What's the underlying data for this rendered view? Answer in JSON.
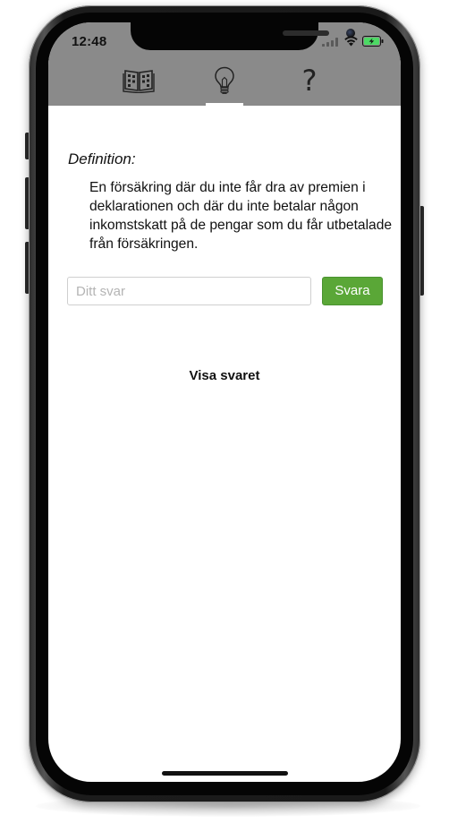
{
  "status_bar": {
    "time": "12:48"
  },
  "tabs": [
    {
      "icon": "book-icon",
      "label": ""
    },
    {
      "icon": "lightbulb-icon",
      "label": ""
    },
    {
      "icon": "question-icon",
      "glyph": "?"
    }
  ],
  "active_tab": "lightbulb",
  "question": {
    "label": "Definition:",
    "text": "En försäkring där du inte får dra av premien i deklarationen och där du inte betalar någon inkomstskatt på de pengar som du får utbetalade från försäkringen."
  },
  "answer_input": {
    "placeholder": "Ditt svar",
    "value": ""
  },
  "submit_label": "Svara",
  "show_answer_label": "Visa svaret",
  "colors": {
    "header_bg": "#8a8a8a",
    "submit_bg": "#5aa737",
    "battery_fill": "#4cd964"
  }
}
